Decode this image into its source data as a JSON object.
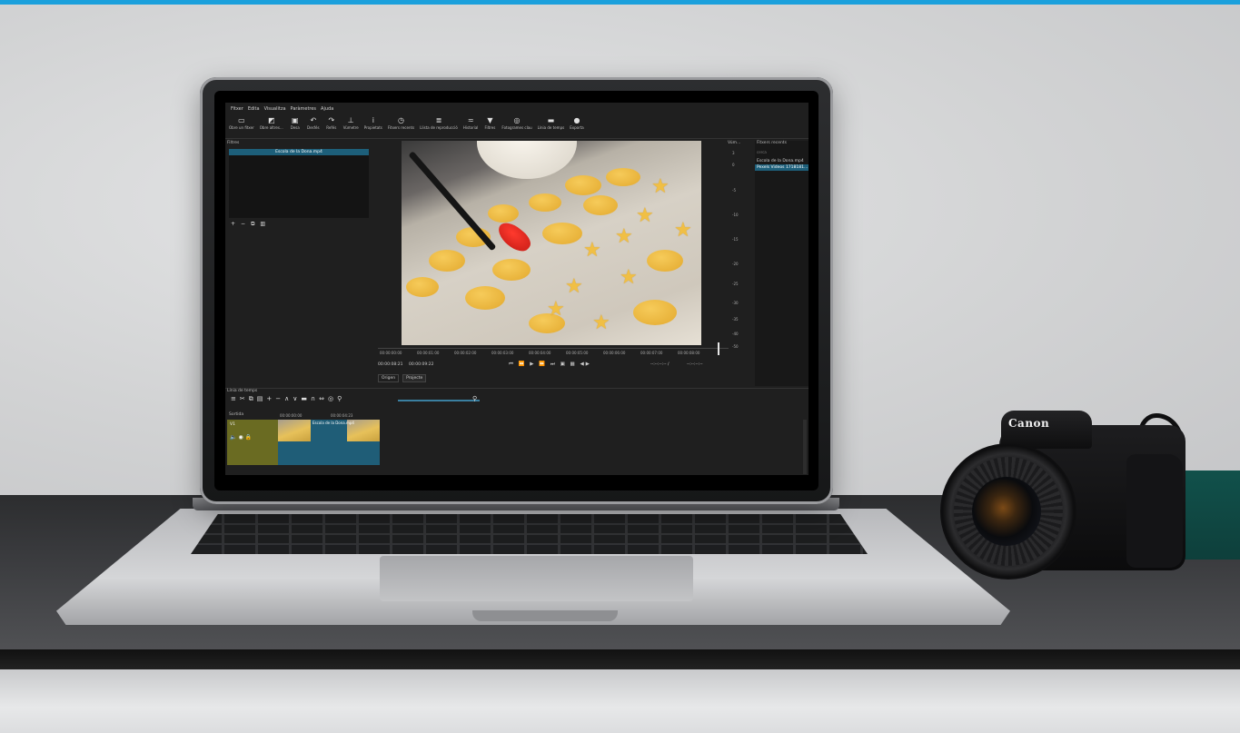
{
  "menu": [
    "Fitxer",
    "Edita",
    "Visualitza",
    "Paràmetres",
    "Ajuda"
  ],
  "toolbar": [
    {
      "label": "Obre un fitxer",
      "icon": "open-file-icon"
    },
    {
      "label": "Obre altres...",
      "icon": "open-other-icon"
    },
    {
      "label": "Desa",
      "icon": "save-icon"
    },
    {
      "label": "Desfés",
      "icon": "undo-icon"
    },
    {
      "label": "Refés",
      "icon": "redo-icon"
    },
    {
      "label": "Vúmetre",
      "icon": "meter-icon"
    },
    {
      "label": "Propietats",
      "icon": "info-icon"
    },
    {
      "label": "Fitxers recents",
      "icon": "recent-icon"
    },
    {
      "label": "Llista de reproducció",
      "icon": "playlist-icon"
    },
    {
      "label": "Historial",
      "icon": "history-icon"
    },
    {
      "label": "Filtres",
      "icon": "filter-icon"
    },
    {
      "label": "Fotogrames clau",
      "icon": "keyframes-icon"
    },
    {
      "label": "Línia de temps",
      "icon": "timeline-icon"
    },
    {
      "label": "Exporta",
      "icon": "export-icon"
    }
  ],
  "filters": {
    "title": "Filtres",
    "item": "Escola de la Dona.mp4"
  },
  "scrubber": {
    "ticks": [
      "00:00:00:00",
      "00:00:01:00",
      "00:00:02:00",
      "00:00:03:00",
      "00:00:04:00",
      "00:00:05:00",
      "00:00:06:00",
      "00:00:07:00",
      "00:00:08:00"
    ]
  },
  "transport": {
    "position": "00:00:08:21",
    "duration": "00:00:09:22",
    "in_point": "--:--:--:-- /",
    "out_point": "--:--:--:--"
  },
  "tabs": [
    "Origen",
    "Projecte"
  ],
  "meter": {
    "title": "Vúm...",
    "levels": [
      "3",
      "0",
      "-5",
      "-10",
      "-15",
      "-20",
      "-25",
      "-30",
      "-35",
      "-40",
      "-50"
    ]
  },
  "recent": {
    "title": "Fitxers recents",
    "search_placeholder": "cerca",
    "items": [
      "Escola de la Dona.mp4",
      "Pexels Videos 1718181..."
    ]
  },
  "timeline": {
    "title": "Línia de temps",
    "output": "Sortida",
    "track": "V1",
    "ruler": [
      "00:00:00:00",
      "00:00:04:23"
    ],
    "clip_label": "Escola de la Dona.mp4"
  },
  "camera": {
    "brand": "Canon"
  },
  "colors": {
    "accent": "#1ba0dc",
    "selection": "#1d5f7a",
    "track_head": "#6a6b22"
  }
}
